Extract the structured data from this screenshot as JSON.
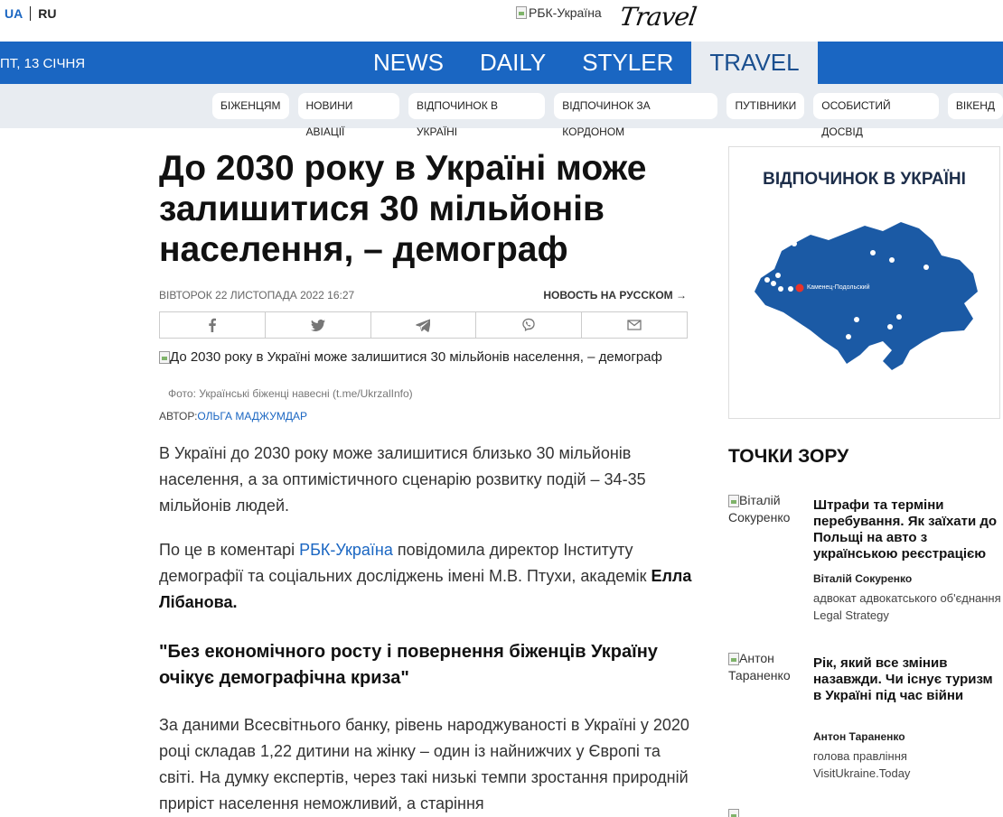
{
  "header": {
    "lang_ua": "UA",
    "lang_ru": "RU",
    "logo_alt": "РБК-Україна",
    "logo_travel": "Travel"
  },
  "navbar": {
    "date": "ПТ, 13 СІЧНЯ",
    "items": [
      {
        "label": "NEWS",
        "active": false
      },
      {
        "label": "DAILY",
        "active": false
      },
      {
        "label": "STYLER",
        "active": false
      },
      {
        "label": "TRAVEL",
        "active": true
      }
    ]
  },
  "subnav": {
    "items": [
      "БІЖЕНЦЯМ",
      "НОВИНИ АВІАЦІЇ",
      "ВІДПОЧИНОК В УКРАЇНІ",
      "ВІДПОЧИНОК ЗА КОРДОНОМ",
      "ПУТІВНИКИ",
      "ОСОБИСТИЙ ДОСВІД",
      "ВІКЕНД"
    ]
  },
  "article": {
    "title": "До 2030 року в Україні може залишитися 30 мільйонів населення, – демограф",
    "date": "ВІВТОРОК 22 ЛИСТОПАДА 2022 16:27",
    "ru_link": "НОВОСТЬ НА РУССКОМ →",
    "share_icons": [
      "facebook-icon",
      "twitter-icon",
      "telegram-icon",
      "viber-icon",
      "email-icon"
    ],
    "hero_alt": "До 2030 року в Україні може залишитися 30 мільйонів населення, – демограф",
    "caption": "Фото: Українські біженці навесні (t.me/UkrzalInfo)",
    "author_label": "АВТОР:",
    "author_name": "ОЛЬГА МАДЖУМДАР",
    "p1": "В Україні до 2030 року може залишитися близько 30 мільйонів населення, а за оптимістичного сценарію розвитку подій – 34-35 мільйонів людей.",
    "p2_pre": "По це в коментарі ",
    "p2_link": "РБК-Україна",
    "p2_post": " повідомила директор Інституту демографії та соціальних досліджень імені М.В. Птухи, академік ",
    "p2_bold": "Елла Лібанова.",
    "quote": "\"Без економічного росту і повернення біженців Україну очікує демографічна криза\"",
    "p3": "За даними Всесвітнього банку, рівень народжуваності в Україні у 2020 році складав 1,22 дитини на жінку – один із найнижчих у Європі та світі. На думку експертів, через такі низькі темпи зростання природній приріст населення неможливий, а старіння"
  },
  "sidebar": {
    "map_title": "ВІДПОЧИНОК В УКРАЇНІ",
    "map_label": "Каменец-Подольский",
    "pov_title": "ТОЧКИ ЗОРУ",
    "opinions": [
      {
        "photo_alt": "Віталій Сокуренко",
        "title": "Штрафи та терміни перебування. Як заїхати до Польщі на авто з українською реєстрацією",
        "author": "Віталій Сокуренко",
        "role": "адвокат адвокатського об'єднання Legal Strategy"
      },
      {
        "photo_alt": "Антон Тараненко",
        "title": "Рік, який все змінив назавжди. Чи існує туризм в Україні під час війни",
        "author": "Антон Тараненко",
        "role": "голова правління VisitUkraine.Today"
      }
    ]
  }
}
